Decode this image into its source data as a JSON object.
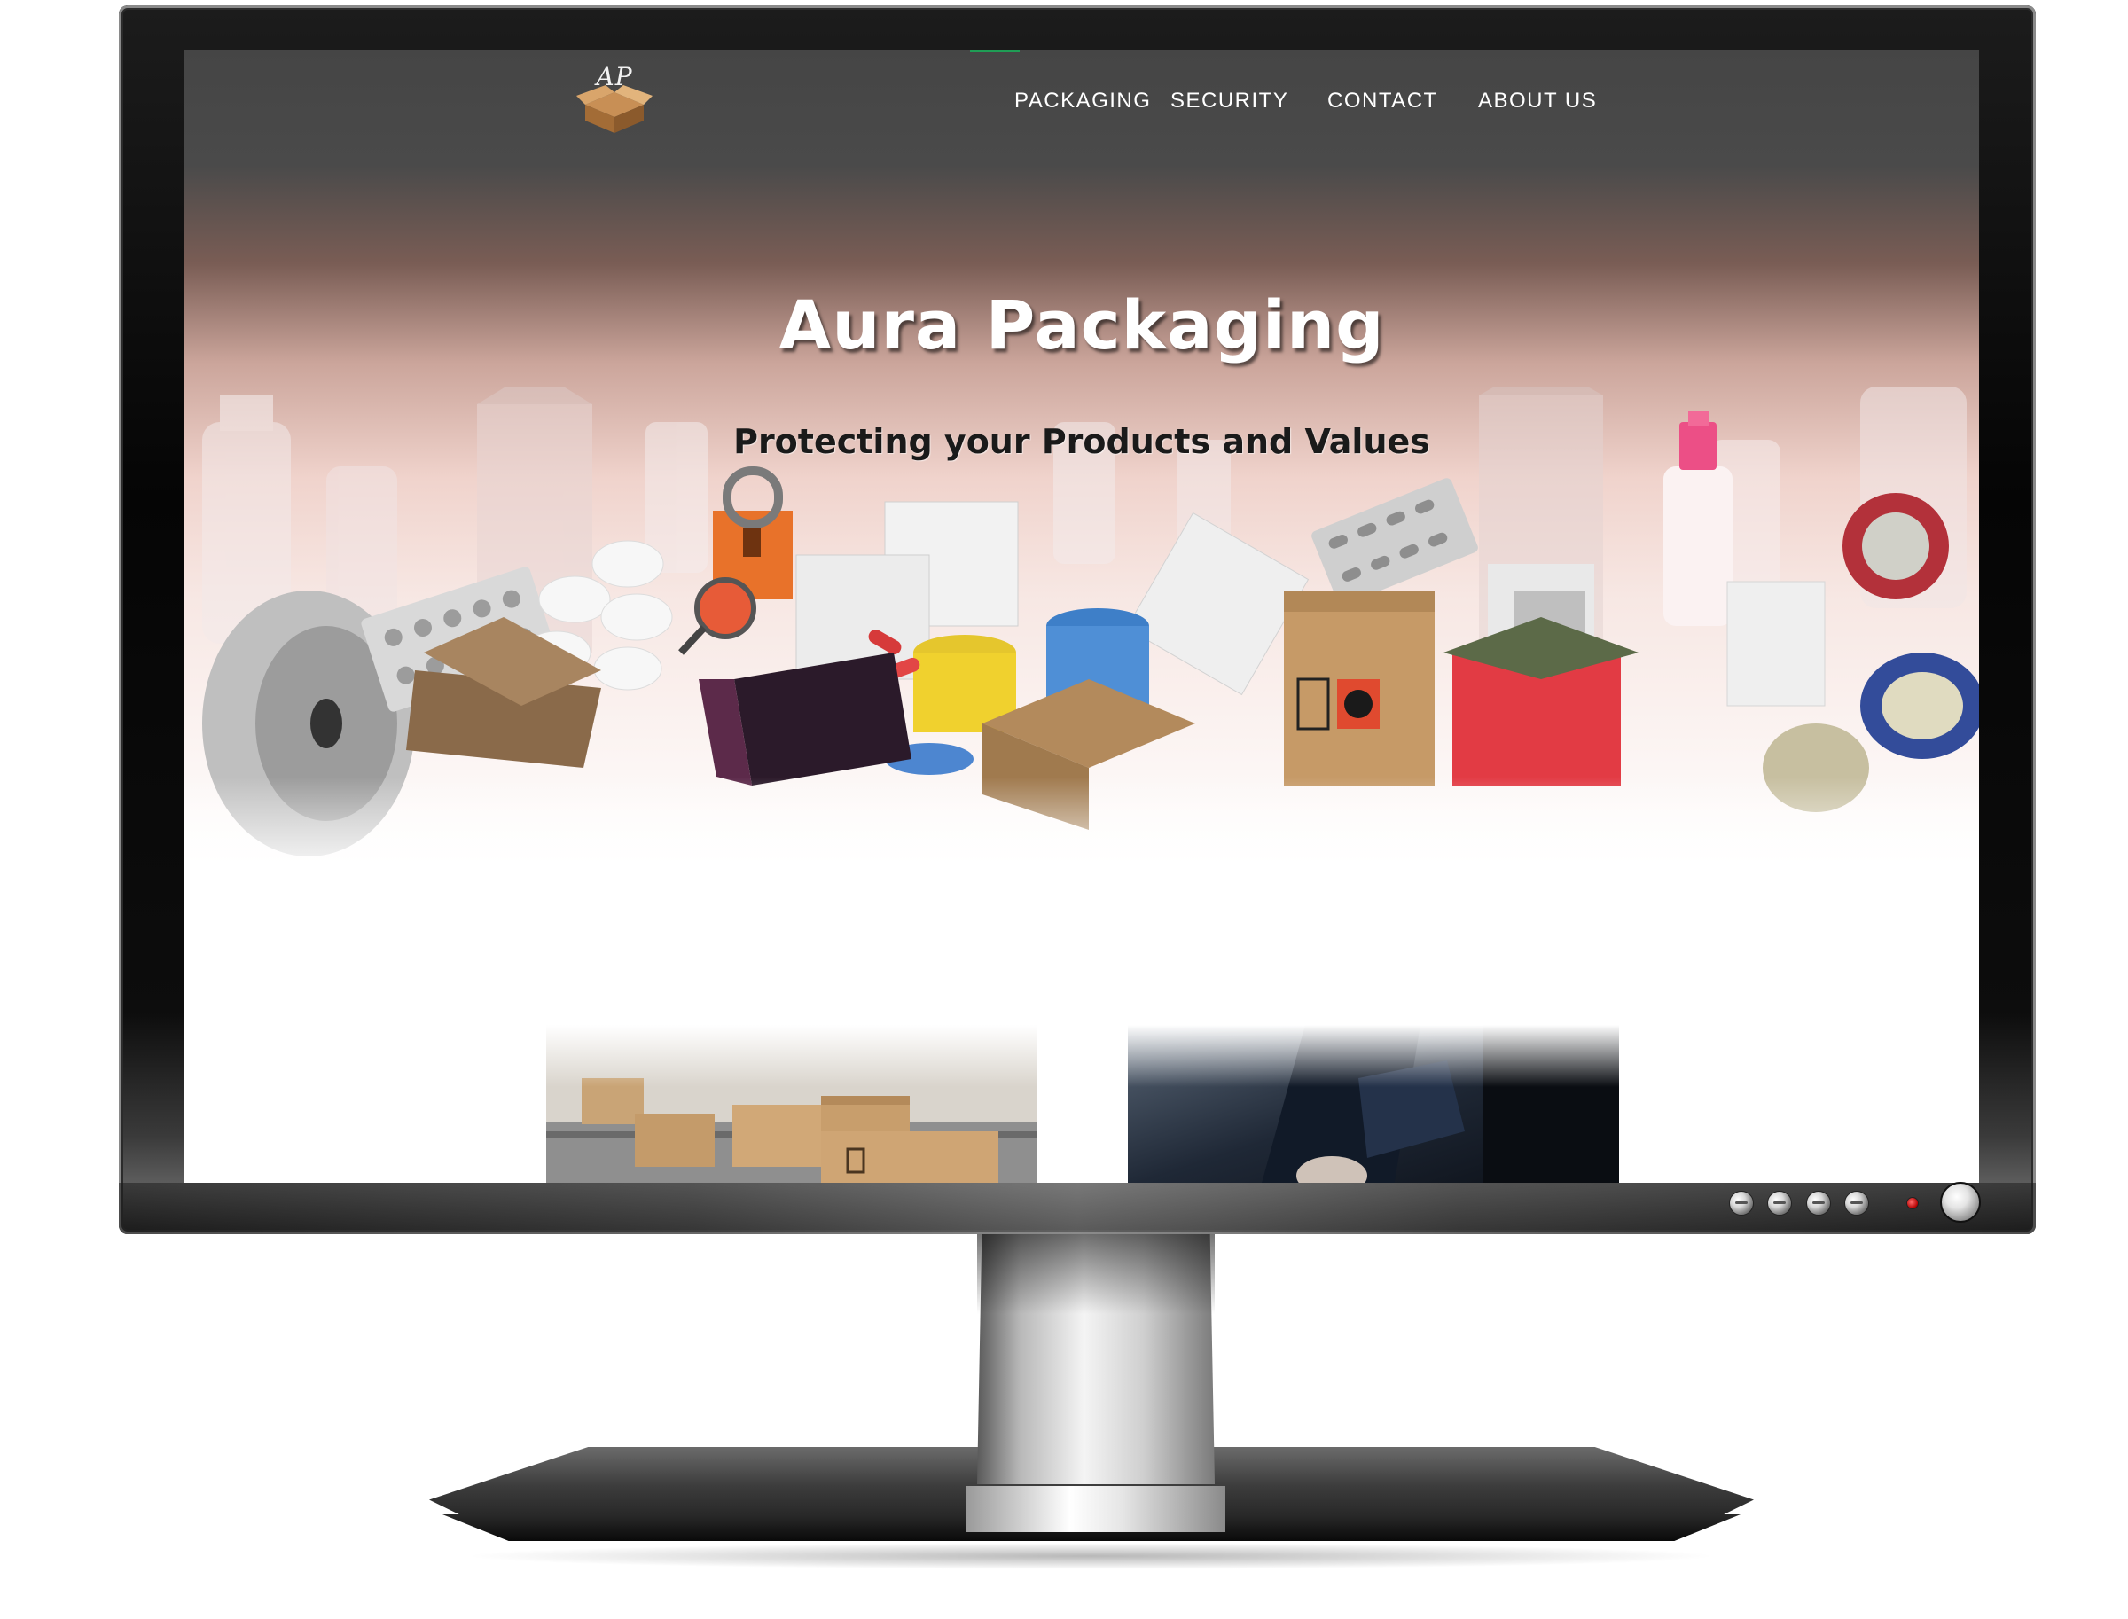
{
  "site": {
    "logo_text": "AP",
    "nav": {
      "packaging": "PACKAGING",
      "security": "SECURITY",
      "contact": "CONTACT",
      "about": "ABOUT US"
    },
    "hero": {
      "title": "Aura Packaging",
      "subtitle": "Protecting your Products and Values"
    },
    "cards": [
      {
        "image": "cardboard-boxes-conveyor"
      },
      {
        "image": "business-handshake"
      }
    ]
  },
  "monitor": {
    "buttons": [
      "menu-button-icon",
      "down-button-icon",
      "up-button-icon",
      "input-button-icon"
    ],
    "led": "power-led-icon",
    "power": "power-button-icon"
  },
  "colors": {
    "nav_text": "#ffffff",
    "hero_top": "#454545",
    "hero_pink": "#f0d3cc",
    "title": "#ffffff",
    "subtitle": "#1a1a1a",
    "accent": "#1f9d55",
    "led": "#d40000"
  }
}
